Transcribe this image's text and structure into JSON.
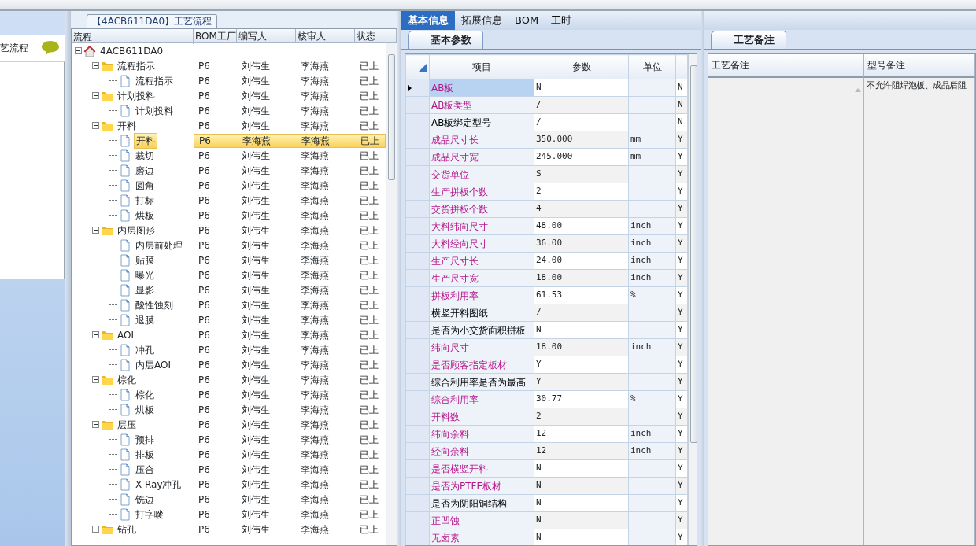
{
  "left_pane": {
    "title": "艺流程"
  },
  "flow_panel": {
    "title": "【4ACB611DA0】工艺流程",
    "columns": [
      "流程",
      "BOM工厂",
      "编写人",
      "核审人",
      "状态"
    ],
    "tree": [
      {
        "label": "4ACB611DA0",
        "kind": "root",
        "expanded": true,
        "selected": false,
        "children": [
          {
            "label": "流程指示",
            "kind": "folder",
            "expanded": true,
            "selected": false,
            "bom": "P6",
            "writer": "刘伟生",
            "reviewer": "李海燕",
            "status": "已上",
            "children": [
              {
                "label": "流程指示",
                "kind": "file",
                "selected": false,
                "bom": "P6",
                "writer": "刘伟生",
                "reviewer": "李海燕",
                "status": "已上"
              }
            ]
          },
          {
            "label": "计划投料",
            "kind": "folder",
            "expanded": true,
            "selected": false,
            "bom": "P6",
            "writer": "刘伟生",
            "reviewer": "李海燕",
            "status": "已上",
            "children": [
              {
                "label": "计划投料",
                "kind": "file",
                "selected": false,
                "bom": "P6",
                "writer": "刘伟生",
                "reviewer": "李海燕",
                "status": "已上"
              }
            ]
          },
          {
            "label": "开料",
            "kind": "folder",
            "expanded": true,
            "selected": false,
            "bom": "P6",
            "writer": "刘伟生",
            "reviewer": "李海燕",
            "status": "已上",
            "children": [
              {
                "label": "开料",
                "kind": "file",
                "selected": true,
                "bom": "P6",
                "writer": "李海燕",
                "reviewer": "李海燕",
                "status": "已上"
              },
              {
                "label": "裁切",
                "kind": "file",
                "selected": false,
                "bom": "P6",
                "writer": "刘伟生",
                "reviewer": "李海燕",
                "status": "已上"
              },
              {
                "label": "磨边",
                "kind": "file",
                "selected": false,
                "bom": "P6",
                "writer": "刘伟生",
                "reviewer": "李海燕",
                "status": "已上"
              },
              {
                "label": "圆角",
                "kind": "file",
                "selected": false,
                "bom": "P6",
                "writer": "刘伟生",
                "reviewer": "李海燕",
                "status": "已上"
              },
              {
                "label": "打标",
                "kind": "file",
                "selected": false,
                "bom": "P6",
                "writer": "刘伟生",
                "reviewer": "李海燕",
                "status": "已上"
              },
              {
                "label": "烘板",
                "kind": "file",
                "selected": false,
                "bom": "P6",
                "writer": "刘伟生",
                "reviewer": "李海燕",
                "status": "已上"
              }
            ]
          },
          {
            "label": "内层图形",
            "kind": "folder",
            "expanded": true,
            "selected": false,
            "bom": "P6",
            "writer": "刘伟生",
            "reviewer": "李海燕",
            "status": "已上",
            "children": [
              {
                "label": "内层前处理",
                "kind": "file",
                "selected": false,
                "bom": "P6",
                "writer": "刘伟生",
                "reviewer": "李海燕",
                "status": "已上"
              },
              {
                "label": "贴膜",
                "kind": "file",
                "selected": false,
                "bom": "P6",
                "writer": "刘伟生",
                "reviewer": "李海燕",
                "status": "已上"
              },
              {
                "label": "曝光",
                "kind": "file",
                "selected": false,
                "bom": "P6",
                "writer": "刘伟生",
                "reviewer": "李海燕",
                "status": "已上"
              },
              {
                "label": "显影",
                "kind": "file",
                "selected": false,
                "bom": "P6",
                "writer": "刘伟生",
                "reviewer": "李海燕",
                "status": "已上"
              },
              {
                "label": "酸性蚀刻",
                "kind": "file",
                "selected": false,
                "bom": "P6",
                "writer": "刘伟生",
                "reviewer": "李海燕",
                "status": "已上"
              },
              {
                "label": "退膜",
                "kind": "file",
                "selected": false,
                "bom": "P6",
                "writer": "刘伟生",
                "reviewer": "李海燕",
                "status": "已上"
              }
            ]
          },
          {
            "label": "AOI",
            "kind": "folder",
            "expanded": true,
            "selected": false,
            "bom": "P6",
            "writer": "刘伟生",
            "reviewer": "李海燕",
            "status": "已上",
            "children": [
              {
                "label": "冲孔",
                "kind": "file",
                "selected": false,
                "bom": "P6",
                "writer": "刘伟生",
                "reviewer": "李海燕",
                "status": "已上"
              },
              {
                "label": "内层AOI",
                "kind": "file",
                "selected": false,
                "bom": "P6",
                "writer": "刘伟生",
                "reviewer": "李海燕",
                "status": "已上"
              }
            ]
          },
          {
            "label": "棕化",
            "kind": "folder",
            "expanded": true,
            "selected": false,
            "bom": "P6",
            "writer": "刘伟生",
            "reviewer": "李海燕",
            "status": "已上",
            "children": [
              {
                "label": "棕化",
                "kind": "file",
                "selected": false,
                "bom": "P6",
                "writer": "刘伟生",
                "reviewer": "李海燕",
                "status": "已上"
              },
              {
                "label": "烘板",
                "kind": "file",
                "selected": false,
                "bom": "P6",
                "writer": "刘伟生",
                "reviewer": "李海燕",
                "status": "已上"
              }
            ]
          },
          {
            "label": "层压",
            "kind": "folder",
            "expanded": true,
            "selected": false,
            "bom": "P6",
            "writer": "刘伟生",
            "reviewer": "李海燕",
            "status": "已上",
            "children": [
              {
                "label": "预排",
                "kind": "file",
                "selected": false,
                "bom": "P6",
                "writer": "刘伟生",
                "reviewer": "李海燕",
                "status": "已上"
              },
              {
                "label": "排板",
                "kind": "file",
                "selected": false,
                "bom": "P6",
                "writer": "刘伟生",
                "reviewer": "李海燕",
                "status": "已上"
              },
              {
                "label": "压合",
                "kind": "file",
                "selected": false,
                "bom": "P6",
                "writer": "刘伟生",
                "reviewer": "李海燕",
                "status": "已上"
              },
              {
                "label": "X-Ray冲孔",
                "kind": "file",
                "selected": false,
                "bom": "P6",
                "writer": "刘伟生",
                "reviewer": "李海燕",
                "status": "已上"
              },
              {
                "label": "铣边",
                "kind": "file",
                "selected": false,
                "bom": "P6",
                "writer": "刘伟生",
                "reviewer": "李海燕",
                "status": "已上"
              },
              {
                "label": "打字嘜",
                "kind": "file",
                "selected": false,
                "bom": "P6",
                "writer": "刘伟生",
                "reviewer": "李海燕",
                "status": "已上"
              }
            ]
          },
          {
            "label": "钻孔",
            "kind": "folder",
            "expanded": true,
            "selected": false,
            "bom": "P6",
            "writer": "刘伟生",
            "reviewer": "李海燕",
            "status": "已上"
          }
        ]
      }
    ]
  },
  "tabs": [
    {
      "label": "基本信息",
      "selected": true
    },
    {
      "label": "拓展信息",
      "selected": false
    },
    {
      "label": "BOM",
      "selected": false
    },
    {
      "label": "工时",
      "selected": false
    }
  ],
  "params": {
    "tab": "基本参数",
    "columns": [
      "项目",
      "参数",
      "单位"
    ],
    "rows": [
      {
        "item": "AB板",
        "value": "N",
        "unit": "",
        "flag": "N",
        "emphasized": true,
        "selected": true
      },
      {
        "item": "AB板类型",
        "value": "/",
        "unit": "",
        "flag": "N",
        "emphasized": true,
        "selected": false
      },
      {
        "item": "AB板绑定型号",
        "value": "/",
        "unit": "",
        "flag": "N",
        "emphasized": false,
        "selected": false
      },
      {
        "item": "成品尺寸长",
        "value": "350.000",
        "unit": "mm",
        "flag": "Y",
        "emphasized": true,
        "selected": false
      },
      {
        "item": "成品尺寸宽",
        "value": "245.000",
        "unit": "mm",
        "flag": "Y",
        "emphasized": true,
        "selected": false
      },
      {
        "item": "交货单位",
        "value": "S",
        "unit": "",
        "flag": "Y",
        "emphasized": true,
        "selected": false
      },
      {
        "item": "生产拼板个数",
        "value": "2",
        "unit": "",
        "flag": "Y",
        "emphasized": true,
        "selected": false
      },
      {
        "item": "交货拼板个数",
        "value": "4",
        "unit": "",
        "flag": "Y",
        "emphasized": true,
        "selected": false
      },
      {
        "item": "大料纬向尺寸",
        "value": "48.00",
        "unit": "inch",
        "flag": "Y",
        "emphasized": true,
        "selected": false
      },
      {
        "item": "大料经向尺寸",
        "value": "36.00",
        "unit": "inch",
        "flag": "Y",
        "emphasized": true,
        "selected": false
      },
      {
        "item": "生产尺寸长",
        "value": "24.00",
        "unit": "inch",
        "flag": "Y",
        "emphasized": true,
        "selected": false
      },
      {
        "item": "生产尺寸宽",
        "value": "18.00",
        "unit": "inch",
        "flag": "Y",
        "emphasized": true,
        "selected": false
      },
      {
        "item": "拼板利用率",
        "value": "61.53",
        "unit": "%",
        "flag": "Y",
        "emphasized": true,
        "selected": false
      },
      {
        "item": "横竖开料图纸",
        "value": "/",
        "unit": "",
        "flag": "Y",
        "emphasized": false,
        "selected": false
      },
      {
        "item": "是否为小交货面积拼板",
        "value": "N",
        "unit": "",
        "flag": "Y",
        "emphasized": false,
        "selected": false
      },
      {
        "item": "纬向尺寸",
        "value": "18.00",
        "unit": "inch",
        "flag": "Y",
        "emphasized": true,
        "selected": false
      },
      {
        "item": "是否顾客指定板材",
        "value": "Y",
        "unit": "",
        "flag": "Y",
        "emphasized": true,
        "selected": false
      },
      {
        "item": "综合利用率是否为最高",
        "value": "Y",
        "unit": "",
        "flag": "Y",
        "emphasized": false,
        "selected": false
      },
      {
        "item": "综合利用率",
        "value": "30.77",
        "unit": "%",
        "flag": "Y",
        "emphasized": true,
        "selected": false
      },
      {
        "item": "开料数",
        "value": "2",
        "unit": "",
        "flag": "Y",
        "emphasized": true,
        "selected": false
      },
      {
        "item": "纬向余料",
        "value": "12",
        "unit": "inch",
        "flag": "Y",
        "emphasized": true,
        "selected": false
      },
      {
        "item": "经向余料",
        "value": "12",
        "unit": "inch",
        "flag": "Y",
        "emphasized": true,
        "selected": false
      },
      {
        "item": "是否横竖开料",
        "value": "N",
        "unit": "",
        "flag": "Y",
        "emphasized": true,
        "selected": false
      },
      {
        "item": "是否为PTFE板材",
        "value": "N",
        "unit": "",
        "flag": "Y",
        "emphasized": true,
        "selected": false
      },
      {
        "item": "是否为阴阳铜结构",
        "value": "N",
        "unit": "",
        "flag": "Y",
        "emphasized": false,
        "selected": false
      },
      {
        "item": "正凹蚀",
        "value": "N",
        "unit": "",
        "flag": "Y",
        "emphasized": true,
        "selected": false
      },
      {
        "item": "无卤素",
        "value": "N",
        "unit": "",
        "flag": "Y",
        "emphasized": true,
        "selected": false
      }
    ]
  },
  "notes": {
    "tab": "工艺备注",
    "columns": [
      "工艺备注",
      "型号备注"
    ],
    "model_note": "不允许阻焊泡板、成品后阻"
  }
}
